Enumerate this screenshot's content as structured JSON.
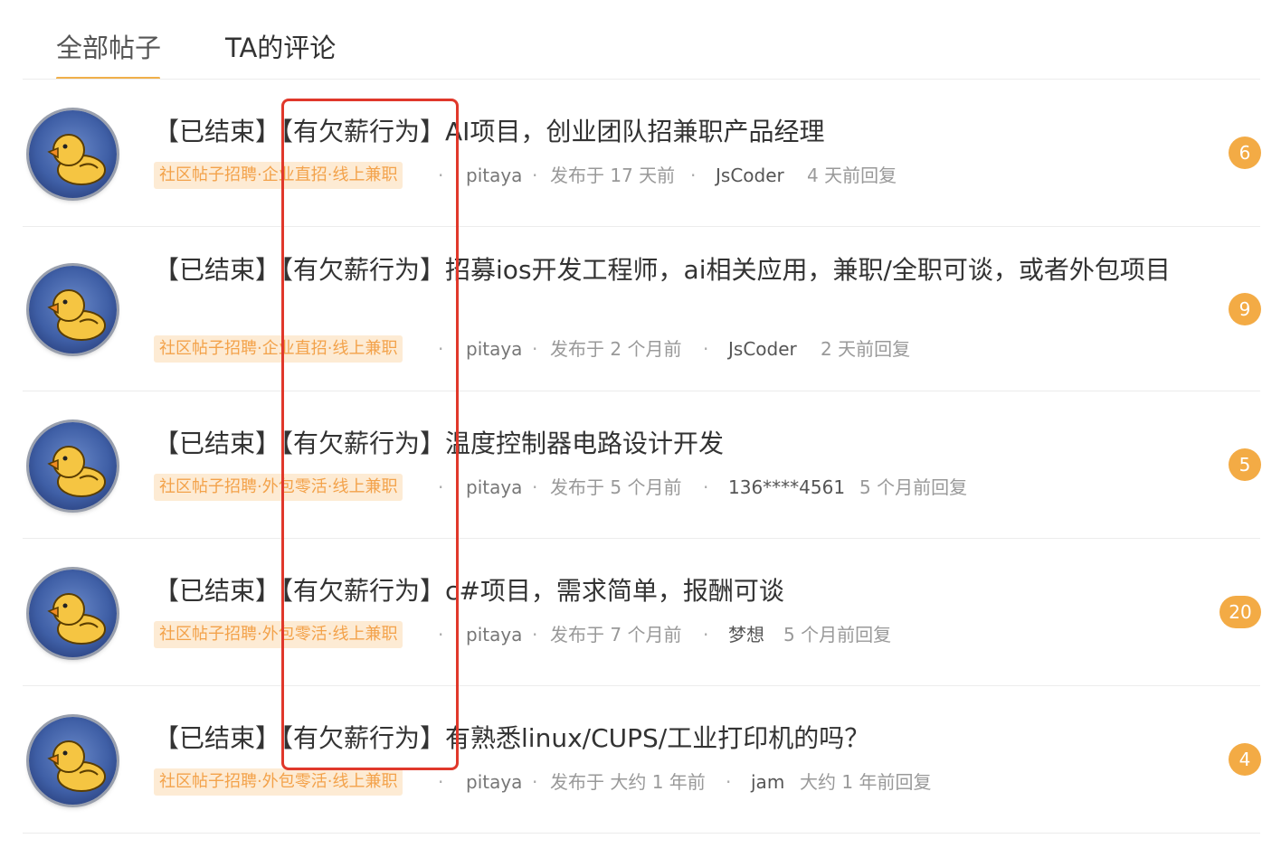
{
  "tabs": [
    {
      "label": "全部帖子",
      "active": true
    },
    {
      "label": "TA的评论",
      "active": false
    }
  ],
  "accent_color": "#f0b04a",
  "highlight_color": "#e0382b",
  "posts": [
    {
      "status": "【已结束】",
      "flag": "【有欠薪行为】",
      "title": "AI项目，创业团队招兼职产品经理",
      "category": "社区帖子招聘·企业直招·线上兼职",
      "author": "pitaya",
      "posted": "发布于 17 天前",
      "replier": "JsCoder",
      "replied": "4 天前回复",
      "reply_count": "6",
      "avatar_icon": "duck-avatar-icon"
    },
    {
      "status": "【已结束】",
      "flag": "【有欠薪行为】",
      "title": "招募ios开发工程师，ai相关应用，兼职/全职可谈，或者外包项目",
      "category": "社区帖子招聘·企业直招·线上兼职",
      "author": "pitaya",
      "posted": "发布于 2 个月前",
      "replier": "JsCoder",
      "replied": "2 天前回复",
      "reply_count": "9",
      "avatar_icon": "duck-avatar-icon"
    },
    {
      "status": "【已结束】",
      "flag": "【有欠薪行为】",
      "title": "温度控制器电路设计开发",
      "category": "社区帖子招聘·外包零活·线上兼职",
      "author": "pitaya",
      "posted": "发布于 5 个月前",
      "replier": "136****4561",
      "replied": "5 个月前回复",
      "reply_count": "5",
      "avatar_icon": "duck-avatar-icon"
    },
    {
      "status": "【已结束】",
      "flag": "【有欠薪行为】",
      "title": "c#项目，需求简单，报酬可谈",
      "category": "社区帖子招聘·外包零活·线上兼职",
      "author": "pitaya",
      "posted": "发布于 7 个月前",
      "replier": "梦想",
      "replied": "5 个月前回复",
      "reply_count": "20",
      "avatar_icon": "duck-avatar-icon"
    },
    {
      "status": "【已结束】",
      "flag": "【有欠薪行为】",
      "title": "有熟悉linux/CUPS/工业打印机的吗？",
      "category": "社区帖子招聘·外包零活·线上兼职",
      "author": "pitaya",
      "posted": "发布于 大约 1 年前",
      "replier": "jam",
      "replied": "大约 1 年前回复",
      "reply_count": "4",
      "avatar_icon": "duck-avatar-icon"
    }
  ]
}
